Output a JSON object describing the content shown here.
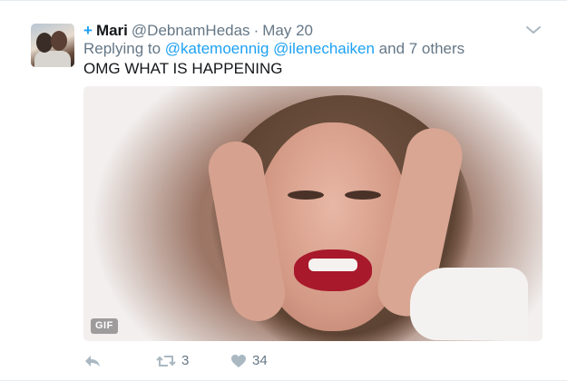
{
  "tweet": {
    "follow_symbol": "+",
    "name": "Mari",
    "handle": "@DebnamHedas",
    "separator": "·",
    "date": "May 20",
    "replying_prefix": "Replying to",
    "mentions": [
      "@katemoennig",
      "@ilenechaiken"
    ],
    "others": "and 7 others",
    "text": "OMG WHAT IS HAPPENING",
    "media_badge": "GIF"
  },
  "actions": {
    "reply_icon": "reply-icon",
    "retweet_icon": "retweet-icon",
    "retweet_count": "3",
    "like_icon": "heart-icon",
    "like_count": "34"
  },
  "colors": {
    "accent": "#1da1f2",
    "secondary_text": "#657786",
    "icon": "#aab8c2"
  }
}
